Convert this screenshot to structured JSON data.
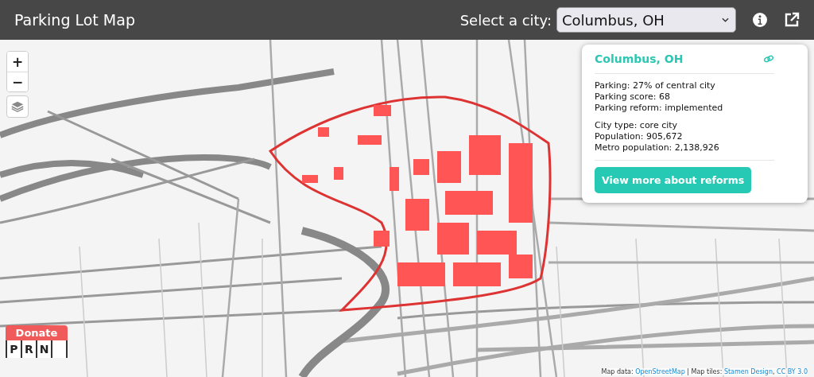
{
  "header": {
    "title": "Parking Lot Map",
    "city_label": "Select a city:",
    "city_value": "Columbus, OH"
  },
  "map": {
    "zoom_in": "+",
    "zoom_out": "−"
  },
  "popup": {
    "title": "Columbus, OH",
    "group_1": [
      "Parking: 27% of central city",
      "Parking score: 68",
      "Parking reform: implemented"
    ],
    "group_2": [
      "City type: core city",
      "Population: 905,672",
      "Metro population: 2,138,926"
    ],
    "button": "View more about reforms"
  },
  "donate": {
    "label": "Donate",
    "letters": [
      "P",
      "R",
      "N"
    ]
  },
  "attribution": [
    {
      "kind": "text",
      "text": "Map data: "
    },
    {
      "kind": "link",
      "text": "OpenStreetMap"
    },
    {
      "kind": "text",
      "text": " | Map tiles: "
    },
    {
      "kind": "link",
      "text": "Stamen Design"
    },
    {
      "kind": "text",
      "text": ", "
    },
    {
      "kind": "link",
      "text": "CC BY 3.0"
    }
  ]
}
